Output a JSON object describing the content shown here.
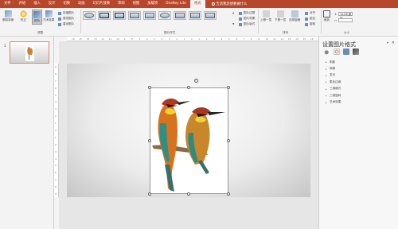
{
  "tabs": [
    "文件",
    "开始",
    "插入",
    "设计",
    "切换",
    "动画",
    "幻灯片放映",
    "审阅",
    "视图",
    "加载项",
    "OneKey Lite",
    "格式"
  ],
  "active_tab": "格式",
  "tell_me": "告诉我您想要做什么",
  "ribbon": {
    "adjust": {
      "remove_bg": "删除背景",
      "correct": "校正",
      "color": "颜色",
      "artistic": "艺术效果",
      "compress": "压缩图片",
      "change": "更改图片",
      "reset": "重设图片",
      "group_label": "调整"
    },
    "styles": {
      "border": "图片边框",
      "effects": "图片效果",
      "layout": "图片版式",
      "group_label": "图片样式"
    },
    "arrange": {
      "forward": "上移一层",
      "backward": "下移一层",
      "selection": "选择窗格",
      "align": "对齐",
      "group": "组合",
      "rotate": "旋转",
      "group_label": "排列"
    },
    "size": {
      "crop": "裁剪",
      "height_value": "14.86 厘米",
      "width_value": "",
      "group_label": "大小"
    }
  },
  "thumbnail": {
    "slide_number": "1"
  },
  "ruler": {
    "h_ticks": [
      "16",
      "15",
      "14",
      "13",
      "12",
      "11",
      "10",
      "9",
      "8",
      "7",
      "6",
      "5",
      "4",
      "3",
      "2",
      "1",
      "0",
      "1",
      "2",
      "3",
      "4",
      "5",
      "6",
      "7",
      "8",
      "9",
      "10",
      "11",
      "12",
      "13",
      "14",
      "15",
      "16"
    ],
    "v_ticks": [
      "9",
      "8",
      "7",
      "6",
      "5",
      "4",
      "3",
      "2",
      "1",
      "0",
      "1",
      "2",
      "3",
      "4",
      "5",
      "6",
      "7",
      "8",
      "9"
    ]
  },
  "format_pane": {
    "title": "设置图片格式",
    "sections": [
      "阴影",
      "映像",
      "发光",
      "柔化边缘",
      "三维格式",
      "三维旋转",
      "艺术效果"
    ]
  },
  "colors": {
    "accent": "#b7472a",
    "selection": "#e0836c"
  }
}
